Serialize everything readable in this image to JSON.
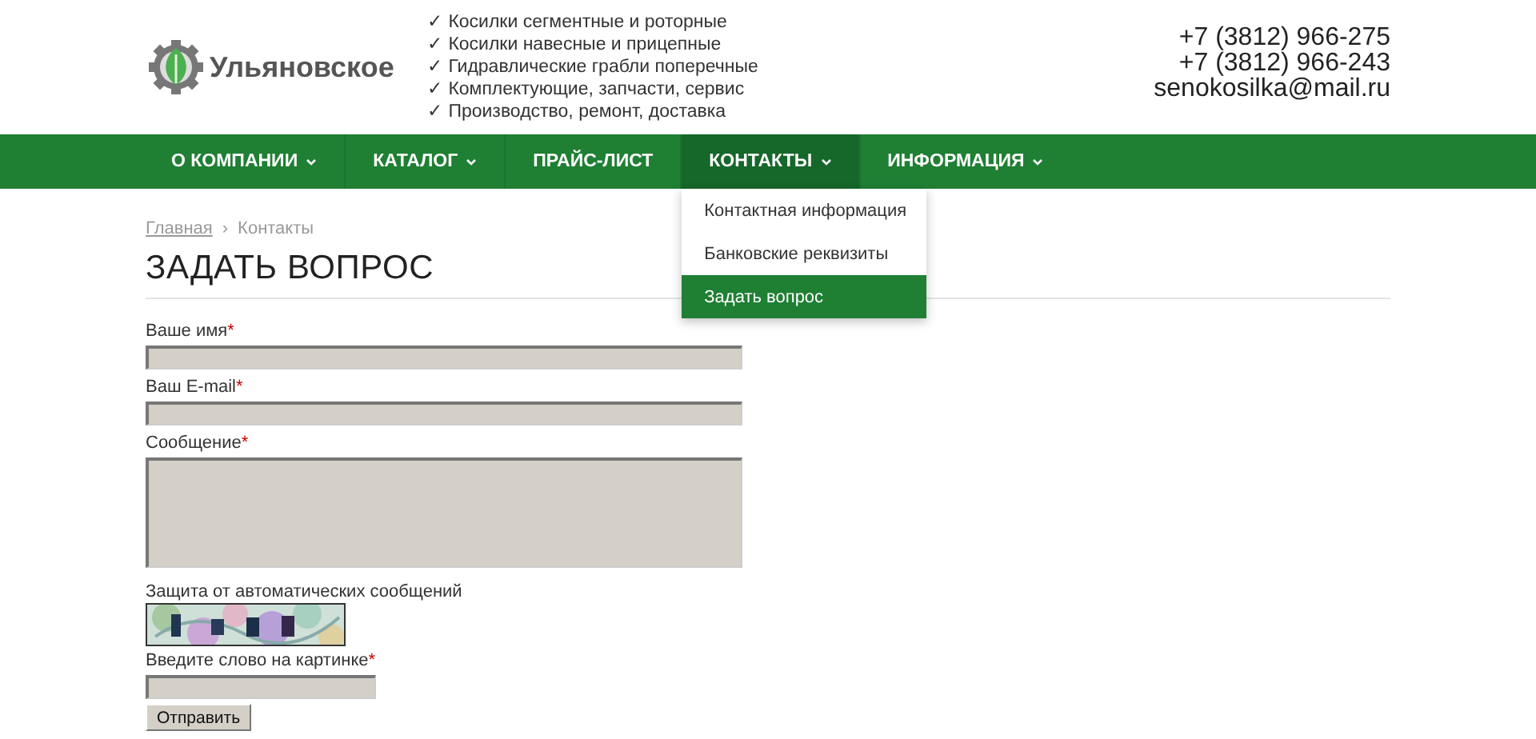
{
  "logo": {
    "text": "Ульяновское"
  },
  "features": [
    "✓ Косилки сегментные и роторные",
    "✓ Косилки навесные и прицепные",
    "✓ Гидравлические грабли поперечные",
    "✓ Комплектующие, запчасти, сервис",
    "✓ Производство, ремонт, доставка"
  ],
  "contacts": {
    "phones": [
      "+7 (3812) 966-275",
      "+7 (3812) 966-243"
    ],
    "email": "senokosilka@mail.ru"
  },
  "nav": [
    {
      "label": "О КОМПАНИИ",
      "dropdown": true,
      "selected": false
    },
    {
      "label": "КАТАЛОГ",
      "dropdown": true,
      "selected": false
    },
    {
      "label": "ПРАЙС-ЛИСТ",
      "dropdown": false,
      "selected": false
    },
    {
      "label": "КОНТАКТЫ",
      "dropdown": true,
      "selected": true,
      "menu": [
        {
          "label": "Контактная информация",
          "selected": false
        },
        {
          "label": "Банковские реквизиты",
          "selected": false
        },
        {
          "label": "Задать вопрос",
          "selected": true
        }
      ]
    },
    {
      "label": "ИНФОРМАЦИЯ",
      "dropdown": true,
      "selected": false
    }
  ],
  "breadcrumb": {
    "items": [
      "Главная",
      "Контакты"
    ],
    "separator": "›"
  },
  "page_title": "ЗАДАТЬ ВОПРОС",
  "form": {
    "fields": [
      {
        "kind": "input",
        "label": "Ваше имя",
        "required_mark": "*"
      },
      {
        "kind": "input",
        "label": "Ваш E-mail",
        "required_mark": "*"
      },
      {
        "kind": "textarea",
        "label": "Сообщение",
        "required_mark": "*"
      },
      {
        "kind": "captcha",
        "label": "Защита от автоматических сообщений"
      },
      {
        "kind": "short",
        "label": "Введите слово на картинке",
        "required_mark": "*"
      }
    ],
    "submit": "Отправить"
  }
}
